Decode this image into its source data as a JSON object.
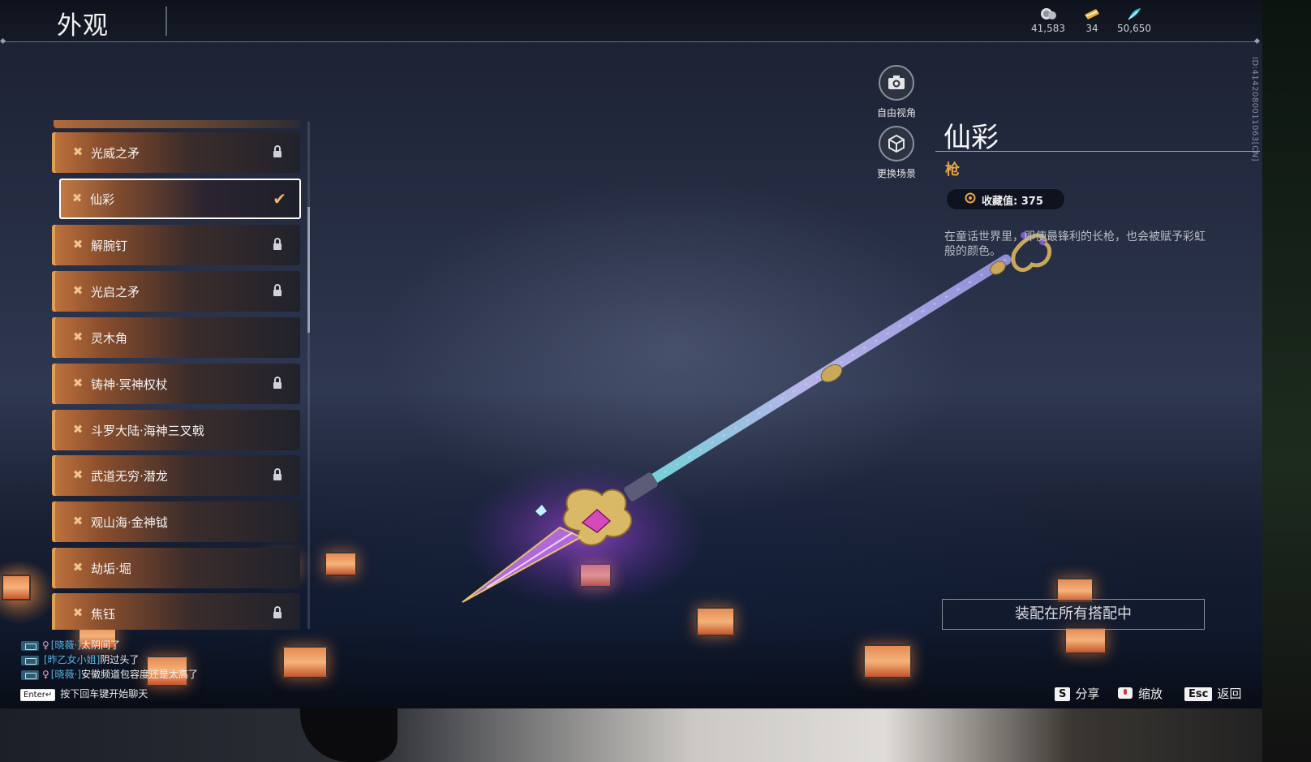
{
  "header": {
    "title": "外观",
    "currencies": [
      {
        "icon": "coin-stack-icon",
        "value": "41,583"
      },
      {
        "icon": "ticket-icon",
        "value": "34"
      },
      {
        "icon": "feather-icon",
        "value": "50,650"
      }
    ]
  },
  "side_id": "ID:4142080011063[CN]",
  "list": {
    "items": [
      {
        "label": "光威之矛",
        "locked": true,
        "selected": false
      },
      {
        "label": "仙彩",
        "locked": false,
        "selected": true
      },
      {
        "label": "解腕钉",
        "locked": true,
        "selected": false
      },
      {
        "label": "光启之矛",
        "locked": true,
        "selected": false
      },
      {
        "label": "灵木角",
        "locked": false,
        "selected": false
      },
      {
        "label": "铸神·冥神权杖",
        "locked": true,
        "selected": false
      },
      {
        "label": "斗罗大陆·海神三叉戟",
        "locked": false,
        "selected": false
      },
      {
        "label": "武道无穷·潜龙",
        "locked": true,
        "selected": false
      },
      {
        "label": "观山海·金神钺",
        "locked": false,
        "selected": false
      },
      {
        "label": "劫垢·堀",
        "locked": false,
        "selected": false
      },
      {
        "label": "焦钰",
        "locked": true,
        "selected": false
      }
    ]
  },
  "view_buttons": {
    "free_camera": "自由视角",
    "change_scene": "更换场景"
  },
  "detail": {
    "name": "仙彩",
    "type": "枪",
    "collection_label": "收藏值: 375",
    "description": "在童话世界里，即使最锋利的长枪，也会被赋予彩虹般的颜色。",
    "equip_button": "装配在所有搭配中"
  },
  "chat": {
    "lines": [
      {
        "name": "[晓薇·]",
        "message": "太阴间了",
        "gender": "♀"
      },
      {
        "name": "[昨乙女小姐]",
        "message": "阴过头了",
        "gender": ""
      },
      {
        "name": "[晓薇·]",
        "message": "安徽频道包容度还是太高了",
        "gender": "♀"
      }
    ],
    "enter_key": "Enter↵",
    "hint": "按下回车键开始聊天"
  },
  "bottom_keys": [
    {
      "key": "S",
      "label": "分享"
    },
    {
      "key": "",
      "label": "缩放"
    },
    {
      "key": "Esc",
      "label": "返回"
    }
  ],
  "colors": {
    "accent_orange": "#e6a449",
    "selected_border": "#ffffff",
    "chat_name": "#56b7e6"
  }
}
